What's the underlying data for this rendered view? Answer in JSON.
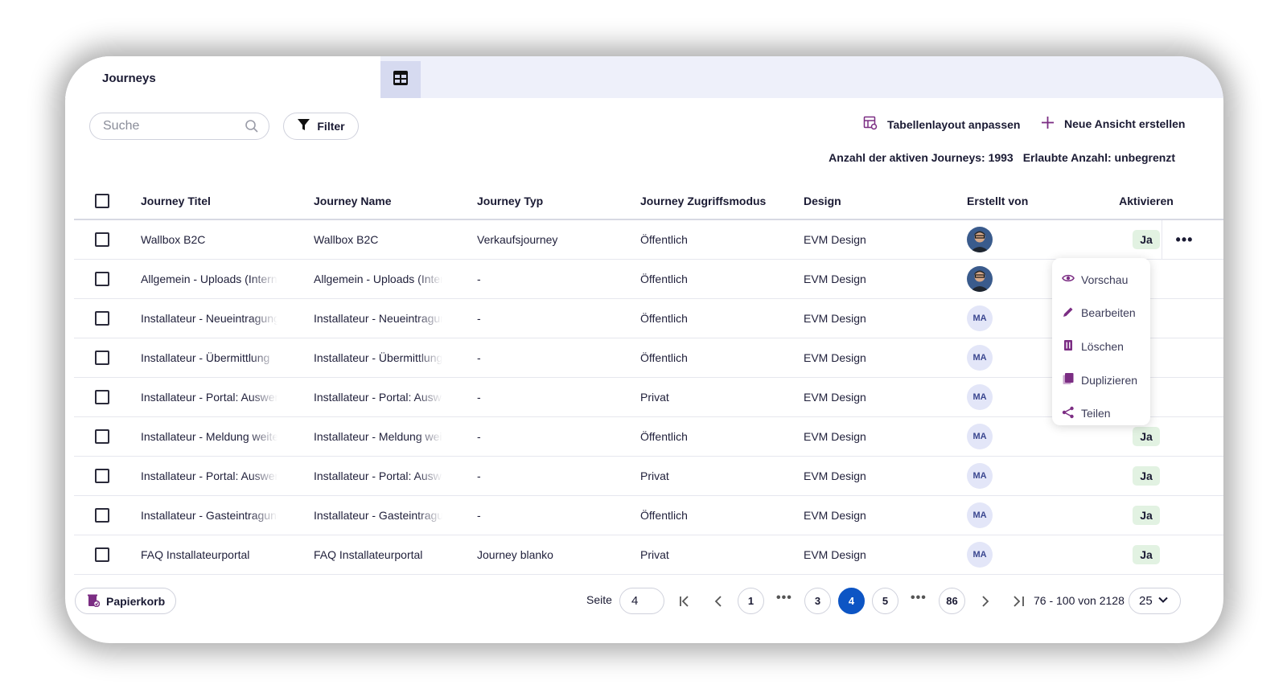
{
  "tab": {
    "title": "Journeys",
    "view_icon": "table-icon"
  },
  "toolbar": {
    "search_placeholder": "Suche",
    "filter_label": "Filter",
    "layout_label": "Tabellenlayout anpassen",
    "new_view_label": "Neue Ansicht erstellen",
    "active_count_text": "Anzahl der aktiven Journeys: 1993",
    "allowed_text": "Erlaubte Anzahl: unbegrenzt"
  },
  "table": {
    "columns": [
      "Journey Titel",
      "Journey Name",
      "Journey Typ",
      "Journey Zugriffsmodus",
      "Design",
      "Erstellt von",
      "Aktivieren"
    ],
    "rows": [
      {
        "title": "Wallbox B2C",
        "name": "Wallbox B2C",
        "typ": "Verkaufsjourney",
        "mode": "Öffentlich",
        "design": "EVM Design",
        "creator": "photo",
        "active": "Ja"
      },
      {
        "title": "Allgemein - Uploads (Intern)",
        "name": "Allgemein - Uploads (Intern)",
        "typ": "-",
        "mode": "Öffentlich",
        "design": "EVM Design",
        "creator": "photo",
        "active": ""
      },
      {
        "title": "Installateur - Neueintragung",
        "name": "Installateur - Neueintragung",
        "typ": "-",
        "mode": "Öffentlich",
        "design": "EVM Design",
        "creator": "MA",
        "active": ""
      },
      {
        "title": "Installateur - Übermittlung",
        "name": "Installateur - Übermittlung",
        "typ": "-",
        "mode": "Öffentlich",
        "design": "EVM Design",
        "creator": "MA",
        "active": ""
      },
      {
        "title": "Installateur - Portal: Auswertung",
        "name": "Installateur - Portal: Auswertung",
        "typ": "-",
        "mode": "Privat",
        "design": "EVM Design",
        "creator": "MA",
        "active": ""
      },
      {
        "title": "Installateur - Meldung weiterleiten",
        "name": "Installateur - Meldung weiterleiten",
        "typ": "-",
        "mode": "Öffentlich",
        "design": "EVM Design",
        "creator": "MA",
        "active": "Ja"
      },
      {
        "title": "Installateur - Portal: Auswertung",
        "name": "Installateur - Portal: Auswertung",
        "typ": "-",
        "mode": "Privat",
        "design": "EVM Design",
        "creator": "MA",
        "active": "Ja"
      },
      {
        "title": "Installateur - Gasteintragung",
        "name": "Installateur - Gasteintragung",
        "typ": "-",
        "mode": "Öffentlich",
        "design": "EVM Design",
        "creator": "MA",
        "active": "Ja"
      },
      {
        "title": "FAQ Installateurportal",
        "name": "FAQ Installateurportal",
        "typ": "Journey blanko",
        "mode": "Privat",
        "design": "EVM Design",
        "creator": "MA",
        "active": "Ja"
      }
    ]
  },
  "context_menu": {
    "items": [
      {
        "label": "Vorschau",
        "icon": "eye-icon"
      },
      {
        "label": "Bearbeiten",
        "icon": "pencil-icon"
      },
      {
        "label": "Löschen",
        "icon": "trash-icon"
      },
      {
        "label": "Duplizieren",
        "icon": "copy-icon"
      },
      {
        "label": "Teilen",
        "icon": "share-icon"
      }
    ]
  },
  "footer": {
    "trash_label": "Papierkorb",
    "page_label": "Seite",
    "page_value": "4",
    "pages": [
      "1",
      "3",
      "4",
      "5",
      "86"
    ],
    "ellipsis": "•••",
    "current_page": "4",
    "range_text": "76 - 100 von 2128",
    "per_page": "25"
  },
  "colors": {
    "accent": "#0d55c4",
    "icon_purple": "#7b2d83",
    "badge_green": "#e2f2e2",
    "tab_bar_bg": "#eef0fa",
    "avatar_ma_bg": "#e3e6f8"
  }
}
